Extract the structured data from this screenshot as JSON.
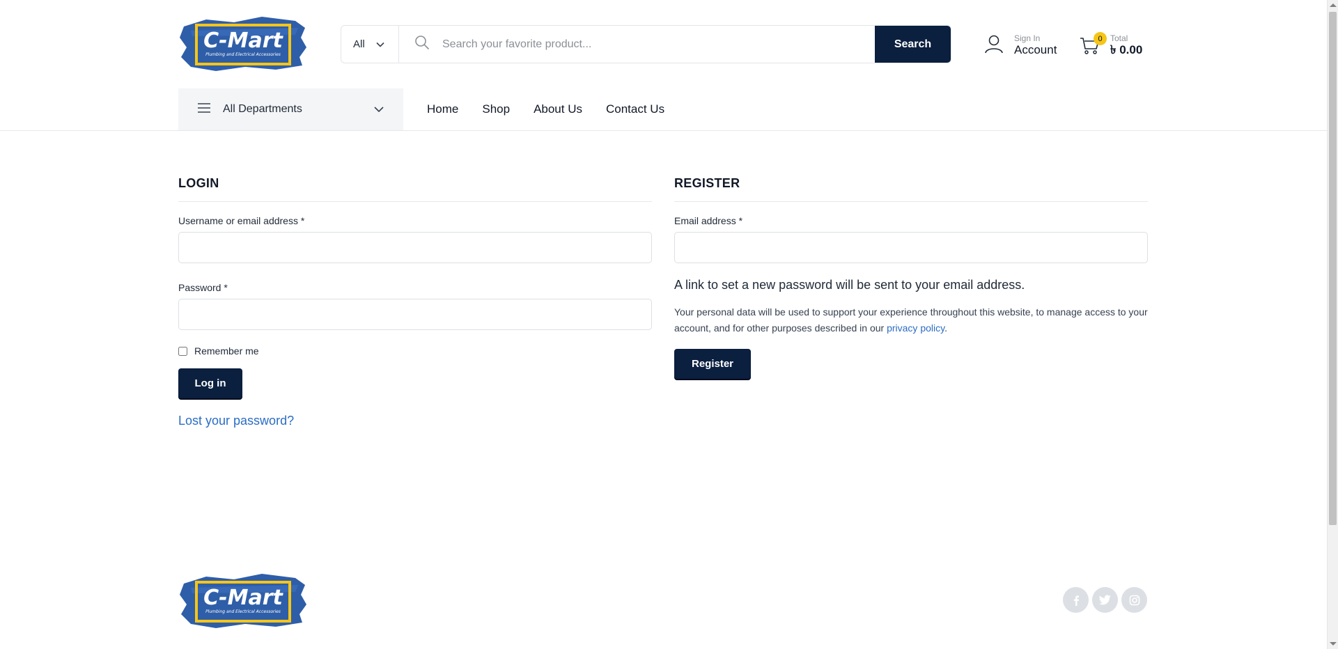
{
  "brand": {
    "logo_text": "C-Mart",
    "logo_tagline": "Plumbing and Electrical Accessories",
    "colors": {
      "navy": "#0b1f3f",
      "logo_blue": "#2f5ea8",
      "logo_yellow": "#f5c518",
      "link": "#2b6cc4"
    }
  },
  "header": {
    "category_select": "All",
    "search_placeholder": "Search your favorite product...",
    "search_button": "Search",
    "account_small": "Sign In",
    "account_big": "Account",
    "cart_count": "0",
    "cart_small": "Total",
    "cart_total": "৳ 0.00"
  },
  "nav": {
    "departments_label": "All Departments",
    "links": [
      "Home",
      "Shop",
      "About Us",
      "Contact Us"
    ]
  },
  "login": {
    "title": "LOGIN",
    "username_label": "Username or email address *",
    "username_value": "",
    "password_label": "Password *",
    "password_value": "",
    "remember_label": "Remember me",
    "remember_checked": false,
    "button": "Log in",
    "lost_password": "Lost your password?"
  },
  "register": {
    "title": "REGISTER",
    "email_label": "Email address *",
    "email_value": "",
    "note": "A link to set a new password will be sent to your email address.",
    "privacy_text": "Your personal data will be used to support your experience throughout this website, to manage access to your account, and for other purposes described in our ",
    "privacy_link": "privacy policy",
    "privacy_end": ".",
    "button": "Register"
  },
  "footer": {
    "social": [
      "facebook-icon",
      "twitter-icon",
      "instagram-icon"
    ]
  }
}
